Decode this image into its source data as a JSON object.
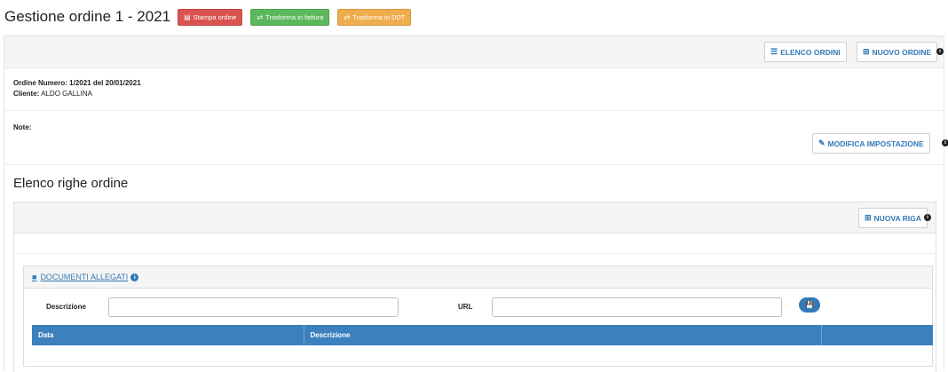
{
  "header": {
    "title": "Gestione ordine 1 - 2021",
    "buttons": {
      "print_label": "Stampa ordine",
      "invoice_label": "Trasforma in fattura",
      "ddt_label": "Trasforma in DDT"
    }
  },
  "toolbar": {
    "list_orders_label": "ELENCO ORDINI",
    "new_order_label": "NUOVO ORDINE"
  },
  "order": {
    "number_label": "Ordine Numero:",
    "number_value": "1/2021 del 20/01/2021",
    "client_label": "Cliente:",
    "client_value": "ALDO GALLINA",
    "note_label": "Note:"
  },
  "edit_settings_label": "MODIFICA IMPOSTAZIONE",
  "rows": {
    "title": "Elenco righe ordine",
    "new_row_label": "NUOVA RIGA"
  },
  "documents": {
    "title": "DOCUMENTI ALLEGATI",
    "description_label": "Descrizione",
    "url_label": "URL",
    "description_value": "",
    "url_value": "",
    "table_headers": [
      "Data",
      "Descrizione",
      ""
    ]
  },
  "icons": {
    "pdf": "file-pdf-icon",
    "exchange": "exchange-icon",
    "list": "list-icon",
    "plus_square": "plus-square-icon",
    "info": "info-circle-icon",
    "edit": "edit-icon",
    "file": "file-icon",
    "save": "save-icon"
  },
  "colors": {
    "danger": "#d9534f",
    "success": "#5cb85c",
    "warning": "#f0ad4e",
    "primary": "#337ab7",
    "table_header": "#3c80be"
  }
}
